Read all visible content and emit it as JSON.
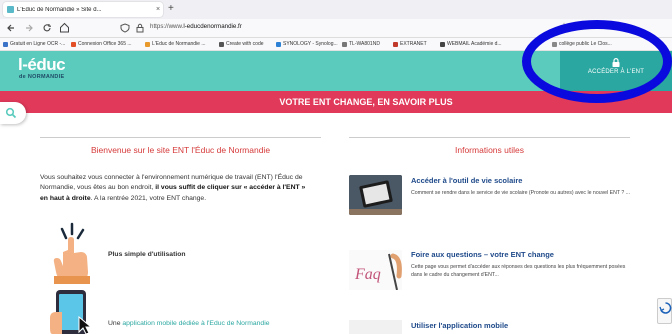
{
  "browser": {
    "tab_title": "L'Educ de Normandie » Site d...",
    "new_tab": "+",
    "tab_close": "×",
    "url_prefix": "https://www.",
    "url_domain": "l-educdenormandie.fr",
    "bookmarks": [
      {
        "label": "Gratuit en Ligne OCR -...",
        "color": "#3b73c8"
      },
      {
        "label": "Connexion Office 365 ...",
        "color": "#e34f26"
      },
      {
        "label": "L'Educ de Normandie ...",
        "color": "#e89a2c"
      },
      {
        "label": "Create with code",
        "color": "#555555"
      },
      {
        "label": "SYNOLOGY - Synolog...",
        "color": "#2e82d6"
      },
      {
        "label": "TL-WA801ND",
        "color": "#777777"
      },
      {
        "label": "EXTRANET",
        "color": "#c0392b"
      },
      {
        "label": "WEBMAIL Académie d...",
        "color": "#444444"
      },
      {
        "label": "collège public Le Clos...",
        "color": "#888888"
      }
    ]
  },
  "site": {
    "logo_main": "l-éduc",
    "logo_sub": "de NORMANDIE",
    "ent_button": "ACCÉDER À L'ENT",
    "banner": "VOTRE ENT CHANGE, EN SAVOIR PLUS",
    "welcome_heading": "Bienvenue sur le site ENT l'Éduc de Normandie",
    "info_heading": "Informations utiles",
    "intro_part1": "Vous souhaitez vous connecter à l'environnement numérique de travail (ENT) l'Éduc de Normandie, vous êtes au bon endroit, ",
    "intro_bold": "il vous suffit de cliquer sur « accéder à l'ENT » en haut à droite",
    "intro_part2": ". A la rentrée 2021, votre ENT change.",
    "feature1": "Plus simple d'utilisation",
    "feature2_pre": "Une ",
    "feature2_link": "application mobile dédiée à l'Educ de Normandie",
    "cards": [
      {
        "title": "Accéder à l'outil de vie scolaire",
        "text": "Comment se rendre dans le service de vie scolaire (Pronote ou autres) avec le nouvel ENT ? ..."
      },
      {
        "title": "Foire aux questions – votre ENT change",
        "text": "Cette page vous permet d'accéder aux réponses des questions les plus fréquemment posées dans le cadre du changement d'ENT..."
      },
      {
        "title": "Utiliser l'application mobile",
        "text": ""
      }
    ],
    "faq_label": "Faq"
  },
  "colors": {
    "header": "#5bcbbd",
    "ent_button": "#2aa7a0",
    "banner": "#e0395a",
    "heading": "#d63a3a",
    "card_title": "#1f4a8a",
    "annotation": "#0a0adf"
  }
}
